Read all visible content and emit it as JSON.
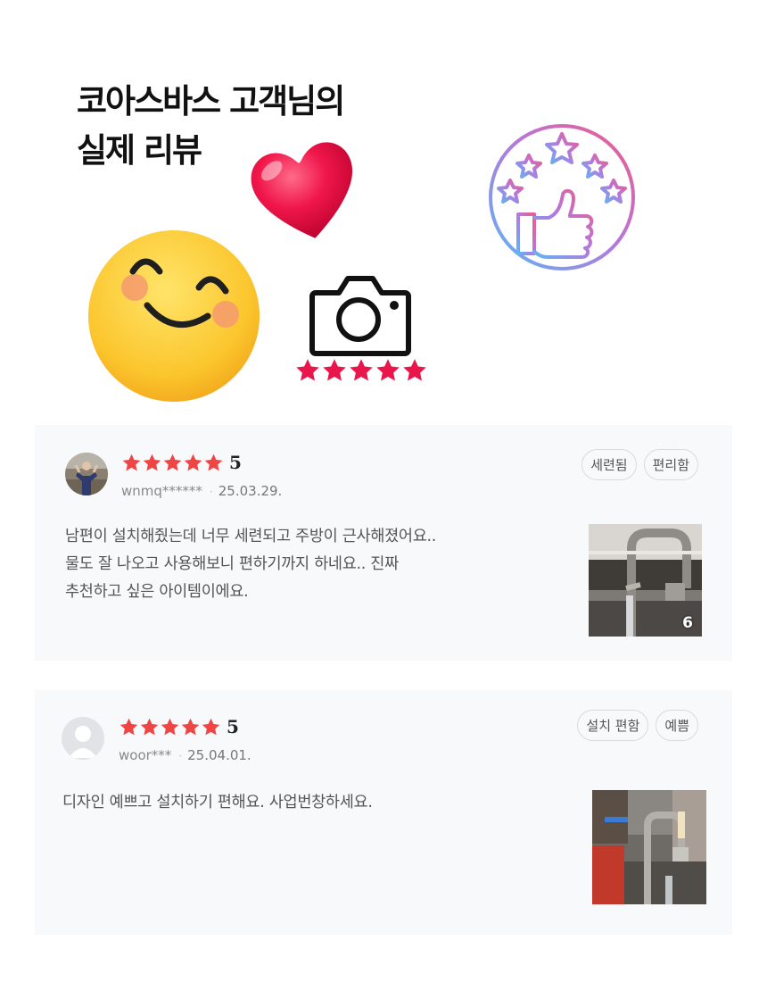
{
  "header": {
    "title_line1": "코아스바스 고객님의",
    "title_line2": "실제 리뷰"
  },
  "stickers": {
    "heart": "heart-icon",
    "badge": "thumbs-up-stars-icon",
    "smiley": "smiling-face-icon",
    "camera": "camera-icon",
    "camera_stars": 5
  },
  "colors": {
    "star_red": "#f04545",
    "sticker_pink": "#e8164a",
    "card_bg": "#f8f9fb"
  },
  "reviews": [
    {
      "rating": 5,
      "rating_text": "5",
      "user": "wnmq******",
      "date": "25.03.29.",
      "tags": [
        "세련됨",
        "편리함"
      ],
      "lines": [
        "남편이 설치해줬는데 너무 세련되고 주방이 근사해졌어요..",
        "물도 잘 나오고 사용해보니 편하기까지 하네요.. 진짜",
        "추천하고 싶은 아이템이에요."
      ],
      "photo_count": "6"
    },
    {
      "rating": 5,
      "rating_text": "5",
      "user": "woor***",
      "date": "25.04.01.",
      "tags": [
        "설치 편함",
        "예쁨"
      ],
      "lines": [
        "디자인 예쁘고 설치하기 편해요. 사업번창하세요."
      ]
    }
  ]
}
